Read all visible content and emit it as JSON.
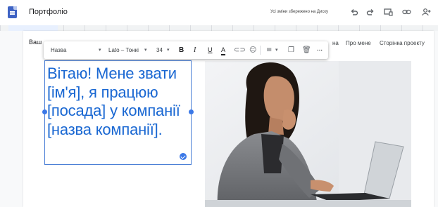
{
  "app": {
    "title": "Портфоліо",
    "save_status": "Усі зміни збережено на Диску"
  },
  "topbar_icons": [
    "undo-icon",
    "redo-icon",
    "preview-icon",
    "link-icon",
    "add-person-icon"
  ],
  "site_nav": {
    "title_partial": "Ваш",
    "link_partial": "на",
    "links": [
      "Про мене",
      "Сторінка проекту"
    ]
  },
  "format_toolbar": {
    "style": "Назва",
    "font": "Lato – Тонкі",
    "size": "34",
    "bold": "B",
    "italic": "I",
    "underline": "U",
    "text_color": "A",
    "more": "⋯"
  },
  "text_box": {
    "content": "Вітаю! Мене звати [ім'я], я працюю [посада] у компанії [назва компанії]."
  },
  "colors": {
    "accent": "#1967d2",
    "selection": "#3b78e7"
  }
}
